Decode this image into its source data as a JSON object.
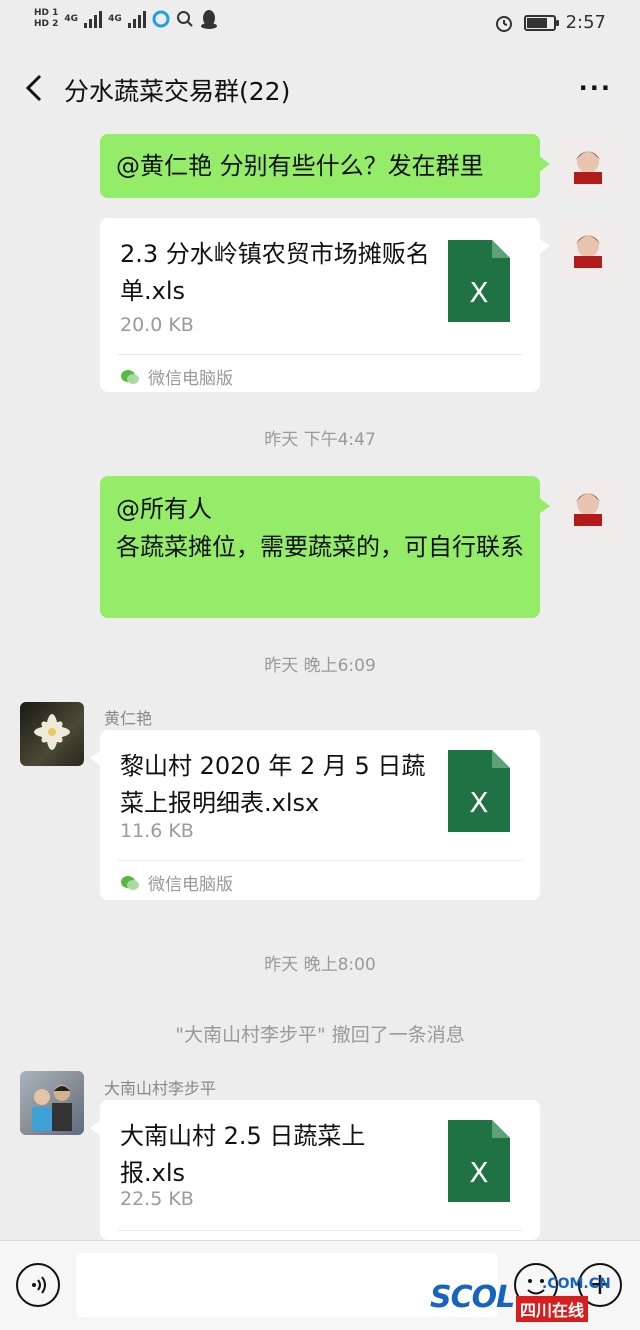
{
  "status_bar": {
    "hd1": "HD 1",
    "hd2": "HD 2",
    "net1": "4G",
    "net2": "4G",
    "time": "2:57",
    "battery_level": 0.8
  },
  "nav": {
    "title": "分水蔬菜交易群(22)",
    "more": "···"
  },
  "messages": {
    "m1_text": "@黄仁艳  分别有些什么？发在群里",
    "m2": {
      "file_name": "2.3 分水岭镇农贸市场摊贩名单.xls",
      "file_size": "20.0 KB",
      "source": "微信电脑版",
      "file_icon_label": "X"
    },
    "time1": "昨天 下午4:47",
    "m3_line1": "@所有人",
    "m3_line2": "各蔬菜摊位，需要蔬菜的，可自行联系",
    "time2": "昨天 晚上6:09",
    "m4": {
      "sender": "黄仁艳",
      "file_name": "黎山村 2020 年 2 月 5 日蔬菜上报明细表.xlsx",
      "file_size": "11.6 KB",
      "source": "微信电脑版",
      "file_icon_label": "X"
    },
    "time3": "昨天 晚上8:00",
    "recall_notice": "\"大南山村李步平\" 撤回了一条消息",
    "m5": {
      "sender": "大南山村李步平",
      "file_name": "大南山村 2.5 日蔬菜上报.xls",
      "file_size": "22.5 KB",
      "file_icon_label": "X"
    }
  },
  "input_bar": {
    "plus": "+"
  },
  "watermark": {
    "brand": "SCOL",
    "domain": ".COM.CN",
    "name": "四川在线"
  },
  "colors": {
    "bubble_green": "#95ec69",
    "excel_green": "#1f7244",
    "background": "#ededed"
  }
}
